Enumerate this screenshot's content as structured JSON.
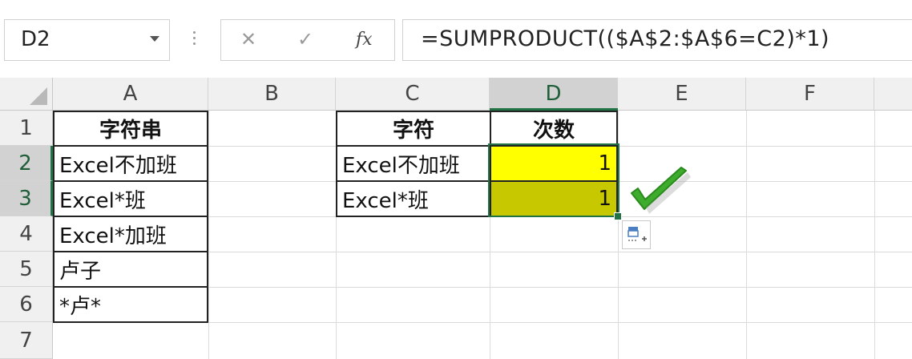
{
  "name_box": {
    "value": "D2"
  },
  "formula_bar": {
    "cancel_icon": "✕",
    "enter_icon": "✓",
    "fx_label": "fx",
    "formula": "=SUMPRODUCT(($A$2:$A$6=C2)*1)"
  },
  "columns": [
    "A",
    "B",
    "C",
    "D",
    "E",
    "F"
  ],
  "rows": [
    "1",
    "2",
    "3",
    "4",
    "5",
    "6",
    "7"
  ],
  "selected": {
    "column": "D",
    "rows": [
      "2",
      "3"
    ]
  },
  "cells": {
    "A1": "字符串",
    "A2": "Excel不加班",
    "A3": "Excel*班",
    "A4": "Excel*加班",
    "A5": "卢子",
    "A6": "*卢*",
    "C1": "字符",
    "C2": "Excel不加班",
    "C3": "Excel*班",
    "D1": "次数",
    "D2": "1",
    "D3": "1"
  },
  "colors": {
    "accent": "#217346",
    "highlight_yellow": "#ffff00",
    "highlight_olive": "#c8c800",
    "check_green": "#3dab2b"
  },
  "icons": {
    "check_overlay": "green-checkmark-icon",
    "quick_analysis": "quick-analysis-icon"
  }
}
